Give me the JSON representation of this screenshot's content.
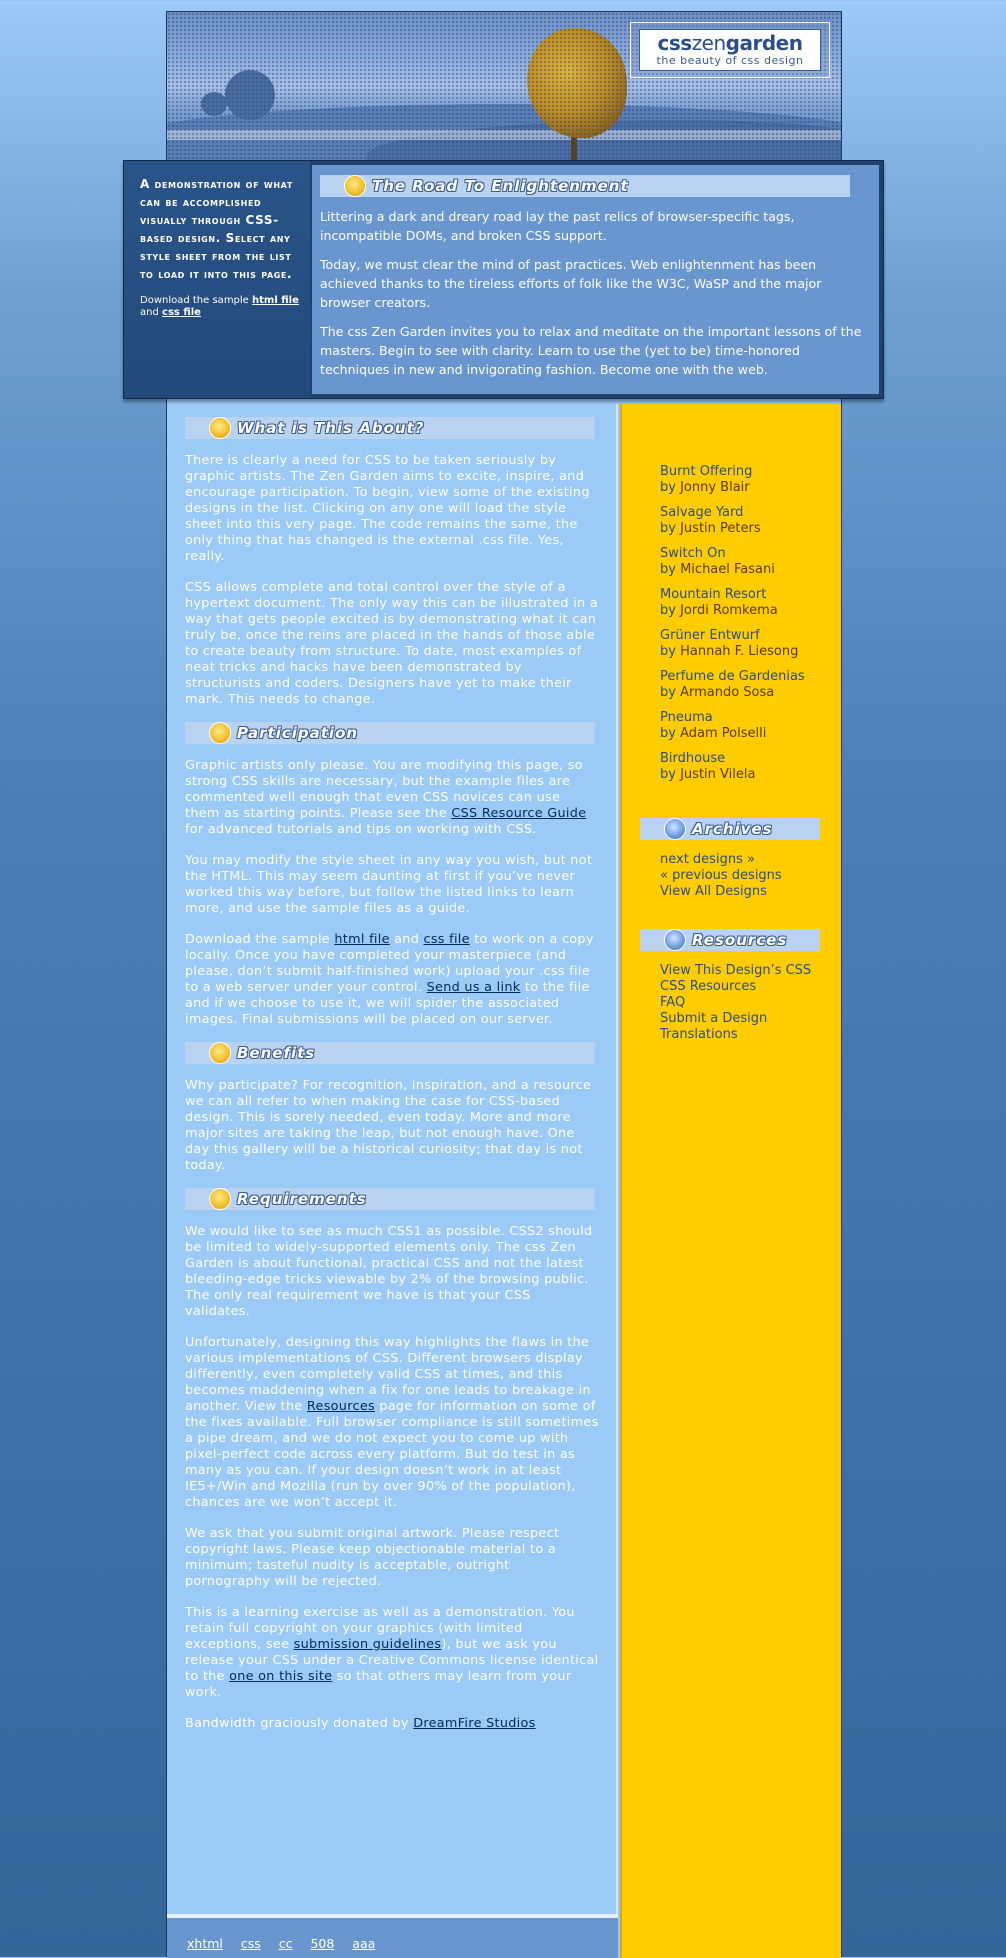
{
  "logo": {
    "css": "css",
    "zen": "zen",
    "garden": "garden",
    "tagline": "the beauty of css design"
  },
  "intro": {
    "summary": "A demonstration of what can be accomplished visually through CSS-based design. Select any style sheet from the list to load it into this page.",
    "download_prefix": "Download the sample",
    "html_file": "html file",
    "and": "and",
    "css_file": "css file",
    "heading": "The Road To Enlightenment",
    "paragraphs": [
      "Littering a dark and dreary road lay the past relics of browser-specific tags, incompatible DOMs, and broken CSS support.",
      "Today, we must clear the mind of past practices. Web enlightenment has been achieved thanks to the tireless efforts of folk like the W3C, WaSP and the major browser creators.",
      "The css Zen Garden invites you to relax and meditate on the important lessons of the masters. Begin to see with clarity. Learn to use the (yet to be) time-honored techniques in new and invigorating fashion. Become one with the web."
    ]
  },
  "main": {
    "about": {
      "heading": "What is This About?",
      "p1": "There is clearly a need for CSS to be taken seriously by graphic artists. The Zen Garden aims to excite, inspire, and encourage participation. To begin, view some of the existing designs in the list. Clicking on any one will load the style sheet into this very page. The code remains the same, the only thing that has changed is the external .css file. Yes, really.",
      "p2": "CSS allows complete and total control over the style of a hypertext document. The only way this can be illustrated in a way that gets people excited is by demonstrating what it can truly be, once the reins are placed in the hands of those able to create beauty from structure. To date, most examples of neat tricks and hacks have been demonstrated by structurists and coders. Designers have yet to make their mark. This needs to change."
    },
    "participation": {
      "heading": "Participation",
      "p1_a": "Graphic artists only please. You are modifying this page, so strong CSS skills are necessary, but the example files are commented well enough that even CSS novices can use them as starting points. Please see the",
      "p1_link": "CSS Resource Guide",
      "p1_b": "for advanced tutorials and tips on working with CSS.",
      "p2": "You may modify the style sheet in any way you wish, but not the HTML. This may seem daunting at first if you’ve never worked this way before, but follow the listed links to learn more, and use the sample files as a guide.",
      "p3_a": "Download the sample",
      "p3_html": "html file",
      "p3_and": "and",
      "p3_css": "css file",
      "p3_b": "to work on a copy locally. Once you have completed your masterpiece (and please, don’t submit half-finished work) upload your .css file to a web server under your control.",
      "p3_send": "Send us a link",
      "p3_c": "to the file and if we choose to use it, we will spider the associated images. Final submissions will be placed on our server."
    },
    "benefits": {
      "heading": "Benefits",
      "p1": "Why participate? For recognition, inspiration, and a resource we can all refer to when making the case for CSS-based design. This is sorely needed, even today. More and more major sites are taking the leap, but not enough have. One day this gallery will be a historical curiosity; that day is not today."
    },
    "requirements": {
      "heading": "Requirements",
      "p1": "We would like to see as much CSS1 as possible. CSS2 should be limited to widely-supported elements only. The css Zen Garden is about functional, practical CSS and not the latest bleeding-edge tricks viewable by 2% of the browsing public. The only real requirement we have is that your CSS validates.",
      "p2_a": "Unfortunately, designing this way highlights the flaws in the various implementations of CSS. Different browsers display differently, even completely valid CSS at times, and this becomes maddening when a fix for one leads to breakage in another. View the",
      "p2_link": "Resources",
      "p2_b": "page for information on some of the fixes available. Full browser compliance is still sometimes a pipe dream, and we do not expect you to come up with pixel-perfect code across every platform. But do test in as many as you can. If your design doesn’t work in at least IE5+/Win and Mozilla (run by over 90% of the population), chances are we won’t accept it.",
      "p3": "We ask that you submit original artwork. Please respect copyright laws. Please keep objectionable material to a minimum; tasteful nudity is acceptable, outright pornography will be rejected.",
      "p4_a": "This is a learning exercise as well as a demonstration. You retain full copyright on your graphics (with limited exceptions, see",
      "p4_link1": "submission guidelines",
      "p4_b": "), but we ask you release your CSS under a Creative Commons license identical to the",
      "p4_link2": "one on this site",
      "p4_c": "so that others may learn from your work.",
      "p5_a": "Bandwidth graciously donated by",
      "p5_link": "DreamFire Studios"
    }
  },
  "sidebar": {
    "designs": [
      {
        "name": "Burnt Offering",
        "by": "by",
        "author": "Jonny Blair"
      },
      {
        "name": "Salvage Yard",
        "by": "by",
        "author": "Justin Peters"
      },
      {
        "name": "Switch On",
        "by": "by",
        "author": "Michael Fasani"
      },
      {
        "name": "Mountain Resort",
        "by": "by",
        "author": "Jordi Romkema"
      },
      {
        "name": "Grüner Entwurf",
        "by": "by",
        "author": "Hannah F. Liesong"
      },
      {
        "name": "Perfume de Gardenias",
        "by": "by",
        "author": "Armando Sosa"
      },
      {
        "name": "Pneuma",
        "by": "by",
        "author": "Adam Polselli"
      },
      {
        "name": "Birdhouse",
        "by": "by",
        "author": "Justin Vilela"
      }
    ],
    "archives": {
      "heading": "Archives",
      "items": [
        "next designs »",
        "« previous designs",
        "View All Designs"
      ]
    },
    "resources": {
      "heading": "Resources",
      "items": [
        "View This Design’s CSS",
        "CSS Resources",
        "FAQ",
        "Submit a Design",
        "Translations"
      ]
    }
  },
  "footer": {
    "links": [
      "xhtml",
      "css",
      "cc",
      "508",
      "aaa"
    ]
  }
}
